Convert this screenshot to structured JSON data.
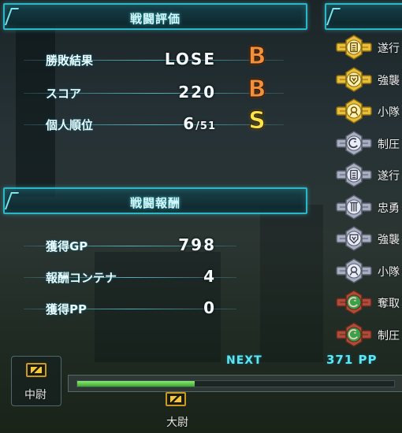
{
  "battle_eval": {
    "title": "戦闘評価",
    "rows": [
      {
        "label": "勝敗結果",
        "value": "LOSE",
        "grade": "B"
      },
      {
        "label": "スコア",
        "value": "220",
        "grade": "B"
      },
      {
        "label": "個人順位",
        "value": "6",
        "value_small": "/51",
        "grade": "S"
      }
    ]
  },
  "battle_reward": {
    "title": "戦闘報酬",
    "rows": [
      {
        "label": "獲得GP",
        "value": "798"
      },
      {
        "label": "報酬コンテナ",
        "value": "4"
      },
      {
        "label": "獲得PP",
        "value": "0"
      }
    ]
  },
  "medals": [
    {
      "name": "遂行",
      "tier": "gold",
      "icon": "document-icon"
    },
    {
      "name": "強襲",
      "tier": "gold",
      "icon": "shield-icon"
    },
    {
      "name": "小隊",
      "tier": "gold",
      "icon": "team-icon"
    },
    {
      "name": "制圧",
      "tier": "silver",
      "icon": "capture-icon"
    },
    {
      "name": "遂行",
      "tier": "silver",
      "icon": "document-icon"
    },
    {
      "name": "忠勇",
      "tier": "silver",
      "icon": "pillar-icon"
    },
    {
      "name": "強襲",
      "tier": "silver",
      "icon": "shield-icon"
    },
    {
      "name": "小隊",
      "tier": "silver",
      "icon": "team-icon"
    },
    {
      "name": "奪取",
      "tier": "bronze",
      "icon": "capture-icon"
    },
    {
      "name": "制圧",
      "tier": "bronze",
      "icon": "capture-icon"
    }
  ],
  "rank": {
    "current": "中尉",
    "next": "大尉",
    "next_label": "NEXT",
    "next_value": "371 PP",
    "progress_fraction": 0.37
  },
  "colors": {
    "accent": "#2fb6c4",
    "grade_b": "#f0913e",
    "grade_s": "#f7e54a",
    "progress": "#5bc94a",
    "gold": "#d8a820",
    "silver": "#9aa0b0",
    "bronze": "#3a8a40"
  }
}
